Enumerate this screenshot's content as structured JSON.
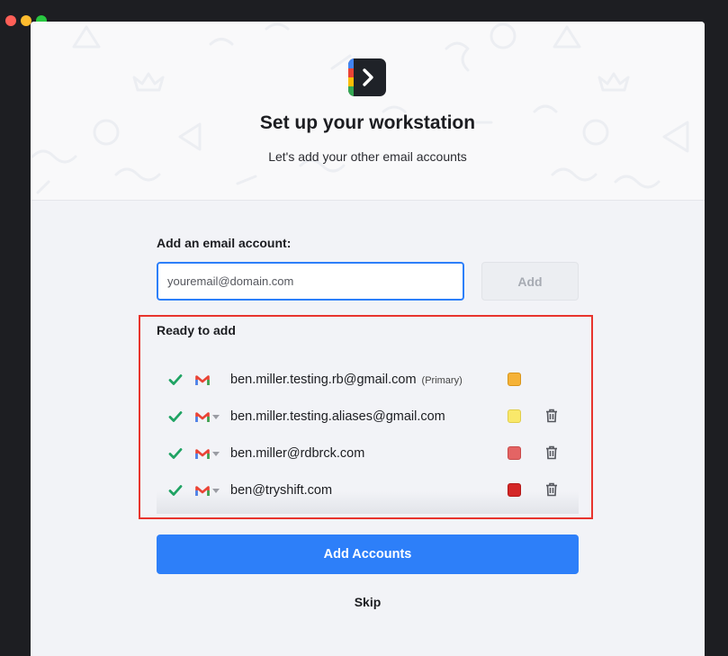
{
  "header": {
    "title": "Set up your workstation",
    "subtitle": "Let's add your other email accounts"
  },
  "add_section": {
    "label": "Add an email account:",
    "input_placeholder": "youremail@domain.com",
    "input_value": "",
    "add_button": "Add"
  },
  "ready": {
    "label": "Ready to add",
    "accounts": [
      {
        "email": "ben.miller.testing.rb@gmail.com",
        "primary_tag": "(Primary)",
        "color": "#f5b237",
        "deletable": false
      },
      {
        "email": "ben.miller.testing.aliases@gmail.com",
        "primary_tag": "",
        "color": "#f9e86a",
        "deletable": true
      },
      {
        "email": "ben.miller@rdbrck.com",
        "primary_tag": "",
        "color": "#e46464",
        "deletable": true
      },
      {
        "email": "ben@tryshift.com",
        "primary_tag": "",
        "color": "#d42626",
        "deletable": true
      }
    ]
  },
  "actions": {
    "add_accounts": "Add Accounts",
    "skip": "Skip"
  },
  "colors": {
    "accent": "#2d7ff9",
    "highlight_border": "#e8342d",
    "check_green": "#1fa363"
  },
  "icons": [
    "app-logo-icon",
    "check-icon",
    "gmail-icon",
    "caret-down-icon",
    "trash-icon"
  ]
}
